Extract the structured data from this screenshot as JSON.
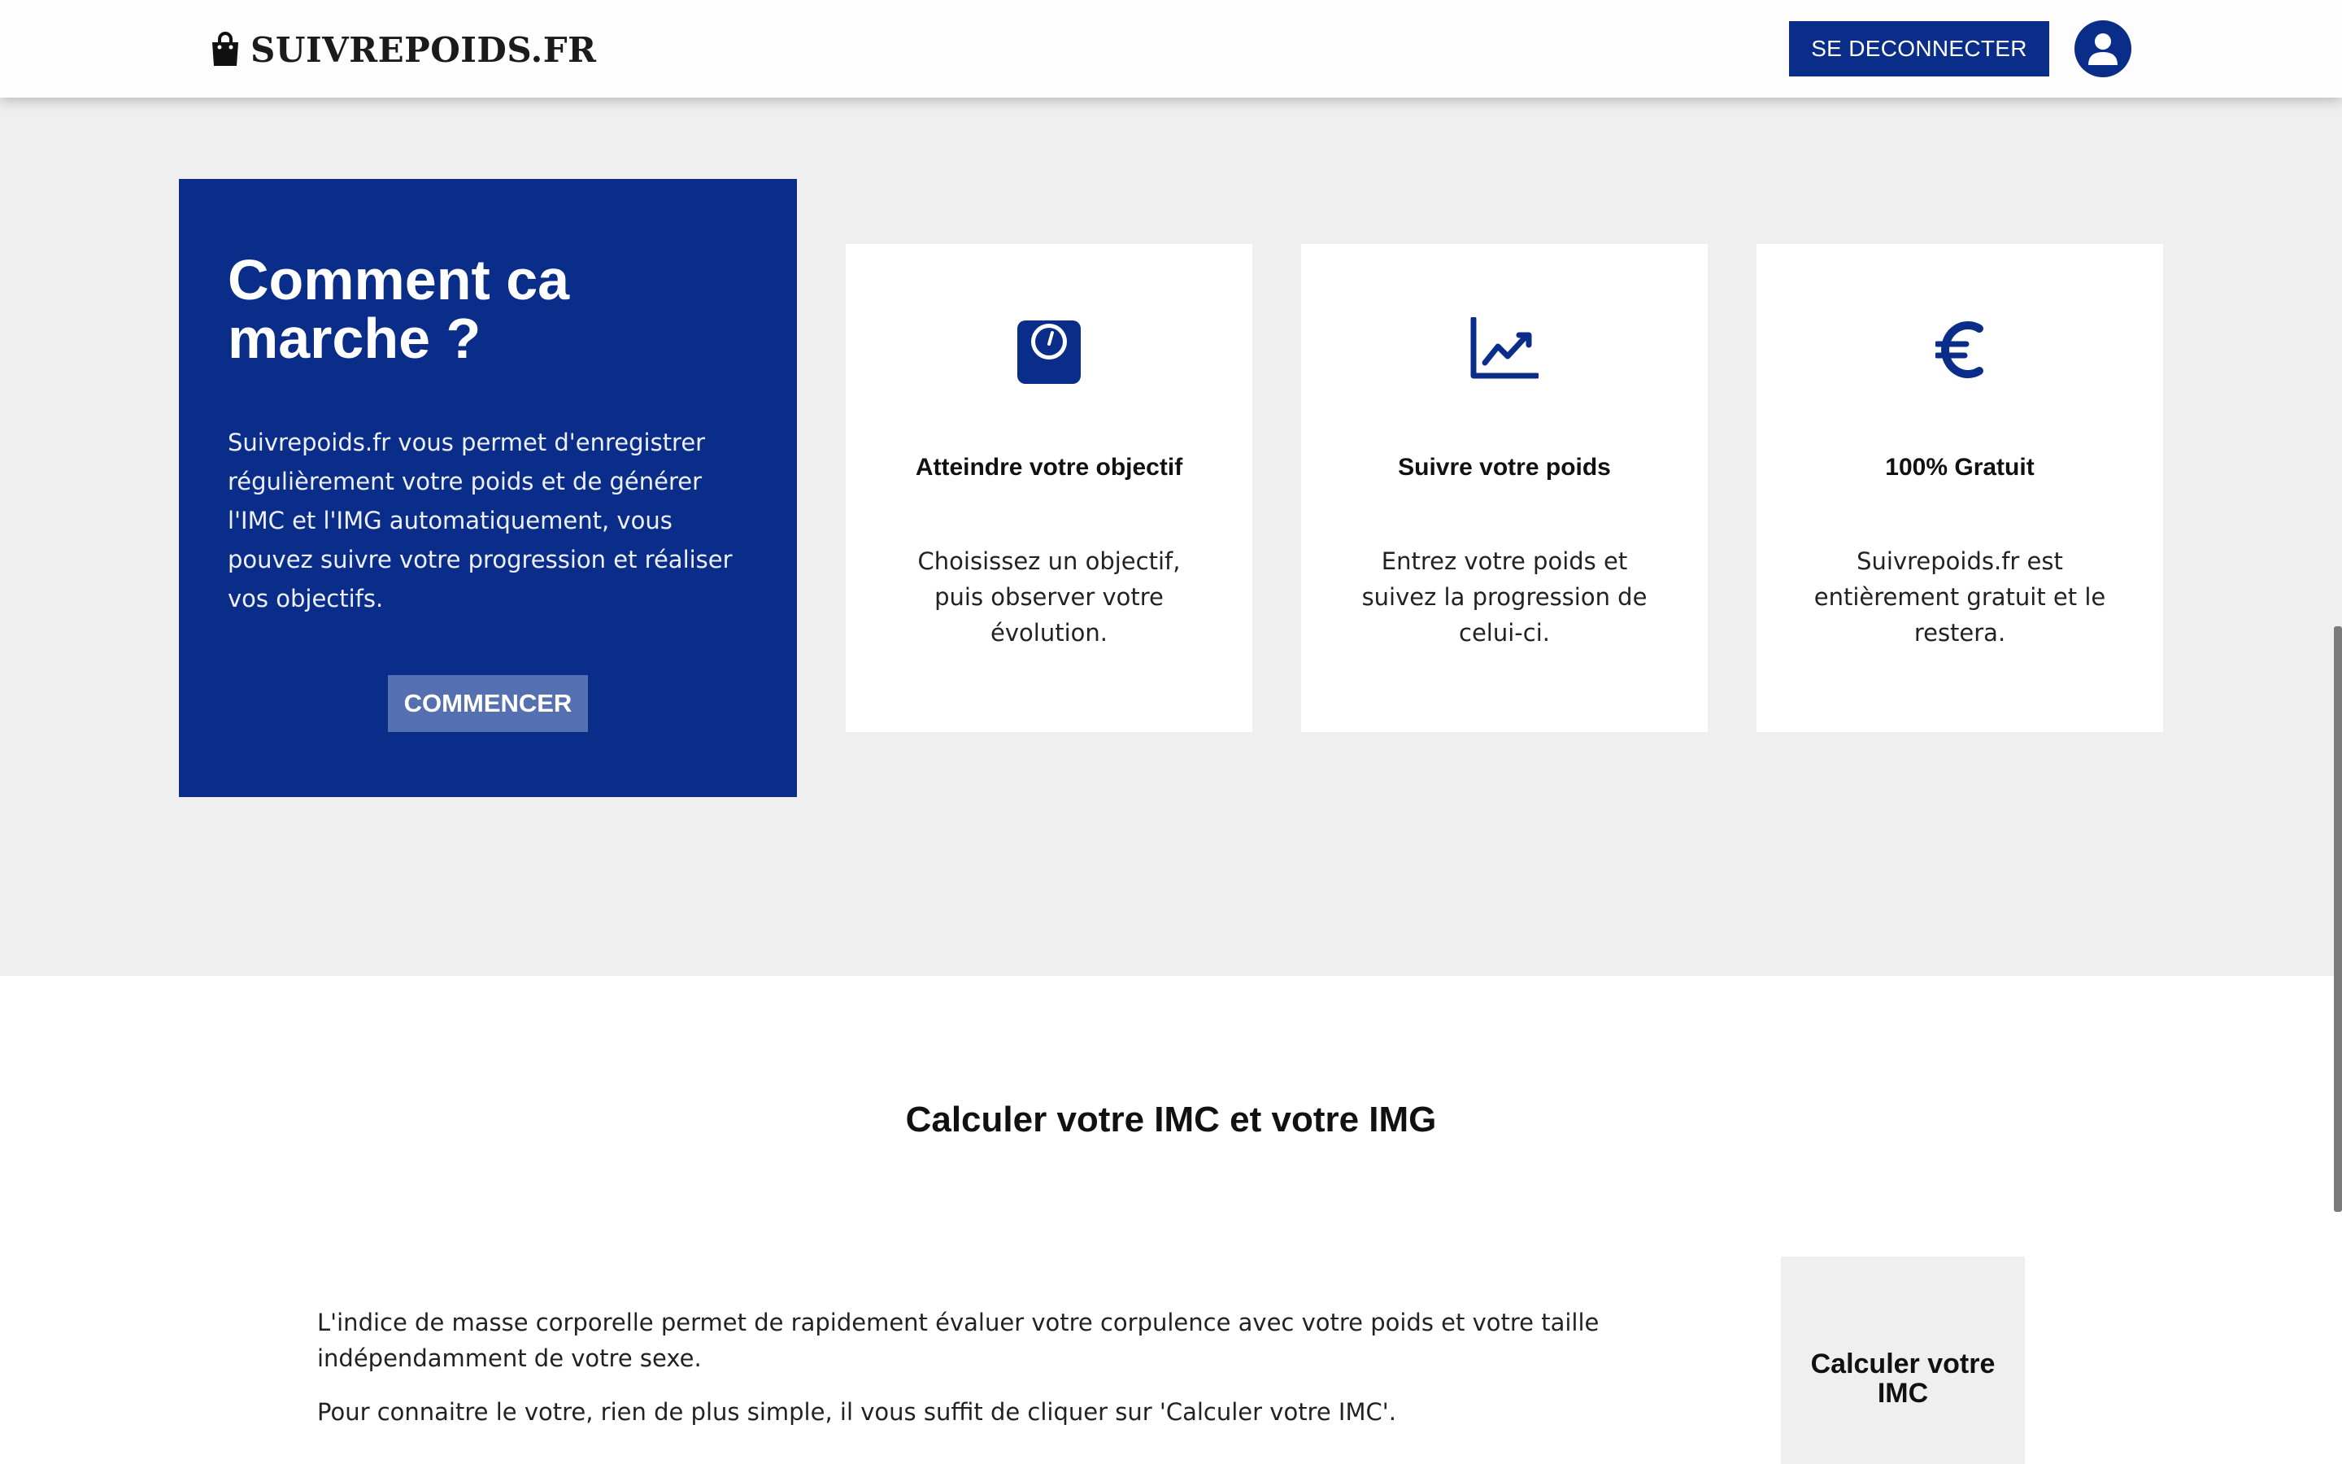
{
  "header": {
    "logo_text": "SUIVREPOIDS.FR",
    "logout_label": "SE DECONNECTER",
    "avatar_icon": "user-circle-icon"
  },
  "howto": {
    "title": "Comment ca marche ?",
    "text": "Suivrepoids.fr vous permet d'enregistrer régulièrement votre poids et de générer l'IMC et l'IMG automatiquement, vous pouvez suivre votre progression et réaliser vos objectifs.",
    "button_label": "COMMENCER"
  },
  "features": [
    {
      "icon": "scale-icon",
      "title": "Atteindre votre objectif",
      "text": "Choisissez un objectif, puis observer votre évolution."
    },
    {
      "icon": "line-chart-icon",
      "title": "Suivre votre poids",
      "text": "Entrez votre poids et suivez la progression de celui-ci."
    },
    {
      "icon": "euro-icon",
      "title": "100% Gratuit",
      "text": "Suivrepoids.fr est entièrement gratuit et le restera."
    }
  ],
  "imc": {
    "title": "Calculer votre IMC et votre IMG",
    "paragraph1": "L'indice de masse corporelle permet de rapidement évaluer votre corpulence avec votre poids et votre taille indépendamment de votre sexe.",
    "paragraph2": "Pour connaitre le votre, rien de plus simple, il vous suffit de cliquer sur 'Calculer votre IMC'.",
    "card_label": "Calculer votre IMC"
  },
  "colors": {
    "brand_blue": "#0b2d8a",
    "button_light_blue": "#5570b0",
    "section_grey": "#efefef"
  }
}
